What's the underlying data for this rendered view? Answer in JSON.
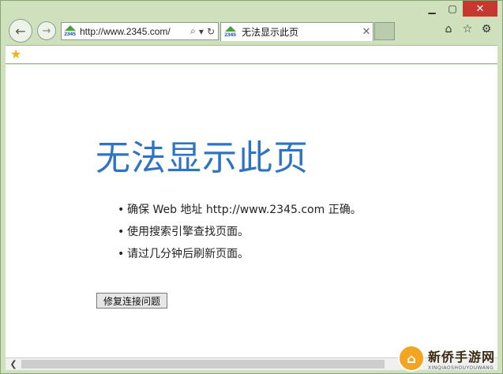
{
  "window": {
    "minimize_glyph": "▁",
    "maximize_glyph": "▢",
    "close_glyph": "✕"
  },
  "nav": {
    "back_icon": "←",
    "forward_icon": "→"
  },
  "address_bar": {
    "site_icon": "2345-logo-icon",
    "site_icon_text": "2345",
    "url": "http://www.2345.com/",
    "search_glyph": "⌕",
    "dropdown_glyph": "▾",
    "refresh_glyph": "↻"
  },
  "tab": {
    "title": "无法显示此页",
    "close_glyph": "✕"
  },
  "toolbar_right": {
    "home_glyph": "⌂",
    "favorites_glyph": "☆",
    "tools_glyph": "⚙"
  },
  "favorites_bar": {
    "add_icon": "★"
  },
  "page": {
    "heading": "无法显示此页",
    "bullets": [
      "确保 Web 地址 http://www.2345.com 正确。",
      "使用搜索引擎查找页面。",
      "请过几分钟后刷新页面。"
    ],
    "fix_button": "修复连接问题"
  },
  "scrollbar": {
    "left_arrow": "❮"
  },
  "watermark": {
    "main": "新侨手游网",
    "sub": "XINQIAOSHOUYOUWANG"
  },
  "colors": {
    "frame": "#cfe1bc",
    "heading": "#2f73c2",
    "close_button": "#c7372f"
  }
}
